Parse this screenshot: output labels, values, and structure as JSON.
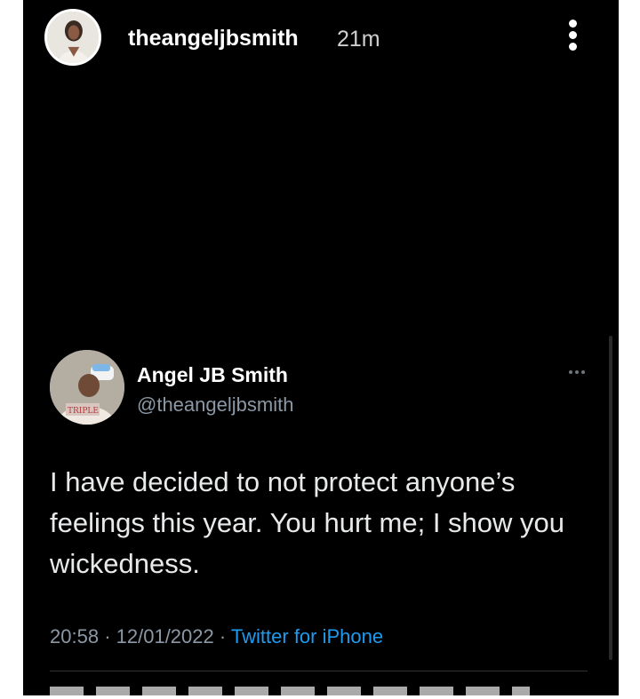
{
  "story": {
    "username": "theangeljbsmith",
    "time": "21m",
    "more_icon": "more-vertical-icon"
  },
  "tweet": {
    "display_name": "Angel JB Smith",
    "handle": "@theangeljbsmith",
    "text": "I have decided to not protect anyone’s feelings this year. You hurt me; I show you wickedness.",
    "time": "20:58",
    "separator": "·",
    "date": "12/01/2022",
    "source": "Twitter for iPhone",
    "more_icon": "more-horizontal-icon"
  },
  "colors": {
    "background": "#000000",
    "text": "#e7e9ea",
    "muted": "#8b98a5",
    "link": "#1d9bf0"
  }
}
